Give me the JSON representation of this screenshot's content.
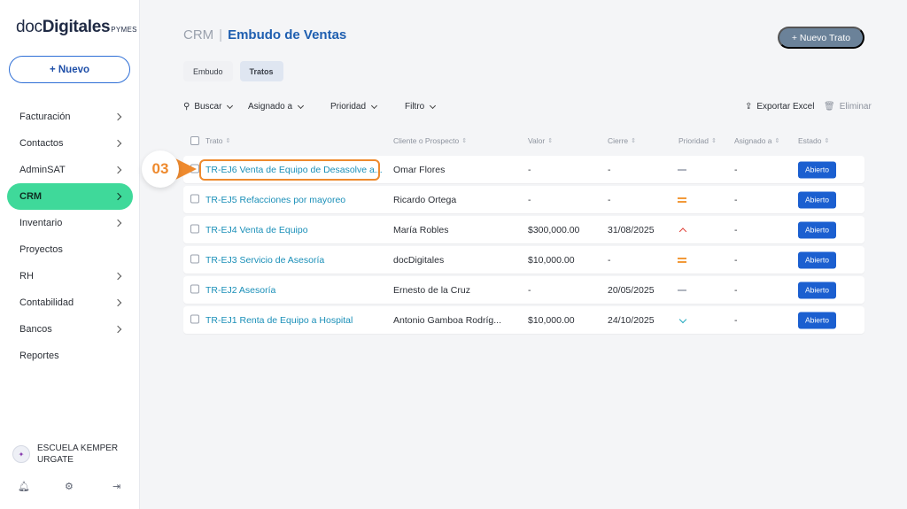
{
  "brand": {
    "name_light": "doc",
    "name_bold": "Digitales",
    "suffix": "PYMES"
  },
  "sidebar": {
    "new_button": "+ Nuevo",
    "items": [
      {
        "label": "Facturación",
        "chevron": true
      },
      {
        "label": "Contactos",
        "chevron": true
      },
      {
        "label": "AdminSAT",
        "chevron": true
      },
      {
        "label": "CRM",
        "chevron": true,
        "active": true
      },
      {
        "label": "Inventario",
        "chevron": true
      },
      {
        "label": "Proyectos",
        "chevron": false
      },
      {
        "label": "RH",
        "chevron": true
      },
      {
        "label": "Contabilidad",
        "chevron": true
      },
      {
        "label": "Bancos",
        "chevron": true
      },
      {
        "label": "Reportes",
        "chevron": false
      }
    ],
    "user": {
      "name": "ESCUELA KEMPER URGATE"
    },
    "footer_icons": [
      "bell-icon",
      "gear-icon",
      "logout-icon"
    ]
  },
  "header": {
    "section": "CRM",
    "separator": "|",
    "title": "Embudo de Ventas",
    "new_deal_button": "+ Nuevo Trato"
  },
  "tabs": [
    {
      "label": "Embudo",
      "selected": false
    },
    {
      "label": "Tratos",
      "selected": true
    }
  ],
  "toolbar": {
    "search": "Buscar",
    "assigned": "Asignado a",
    "priority": "Prioridad",
    "filter": "Filtro",
    "export": "Exportar Excel",
    "delete": "Eliminar"
  },
  "table": {
    "columns": {
      "trato": "Trato",
      "cliente": "Cliente o Prospecto",
      "valor": "Valor",
      "cierre": "Cierre",
      "prioridad": "Prioridad",
      "asignado": "Asignado a",
      "estado": "Estado"
    },
    "rows": [
      {
        "trato": "TR-EJ6 Venta de Equipo de Desasolve a...",
        "cliente": "Omar Flores",
        "valor": "-",
        "cierre": "-",
        "prioridad": "low",
        "asignado": "-",
        "estado": "Abierto"
      },
      {
        "trato": "TR-EJ5 Refacciones por mayoreo",
        "cliente": "Ricardo Ortega",
        "valor": "-",
        "cierre": "-",
        "prioridad": "medium",
        "asignado": "-",
        "estado": "Abierto"
      },
      {
        "trato": "TR-EJ4 Venta de Equipo",
        "cliente": "María Robles",
        "valor": "$300,000.00",
        "cierre": "31/08/2025",
        "prioridad": "high",
        "asignado": "-",
        "estado": "Abierto"
      },
      {
        "trato": "TR-EJ3 Servicio de Asesoría",
        "cliente": "docDigitales",
        "valor": "$10,000.00",
        "cierre": "-",
        "prioridad": "medium",
        "asignado": "-",
        "estado": "Abierto"
      },
      {
        "trato": "TR-EJ2 Asesoría",
        "cliente": "Ernesto de la Cruz",
        "valor": "-",
        "cierre": "20/05/2025",
        "prioridad": "low",
        "asignado": "-",
        "estado": "Abierto"
      },
      {
        "trato": "TR-EJ1 Renta de Equipo a Hospital",
        "cliente": "Antonio Gamboa Rodríg...",
        "valor": "$10,000.00",
        "cierre": "24/10/2025",
        "prioridad": "lowest",
        "asignado": "-",
        "estado": "Abierto"
      }
    ]
  },
  "annotation": {
    "step": "03"
  },
  "colors": {
    "accent": "#1f5fb0",
    "active_nav": "#3fd99a",
    "badge": "#1b5fd0",
    "highlight": "#ee8a2e"
  }
}
